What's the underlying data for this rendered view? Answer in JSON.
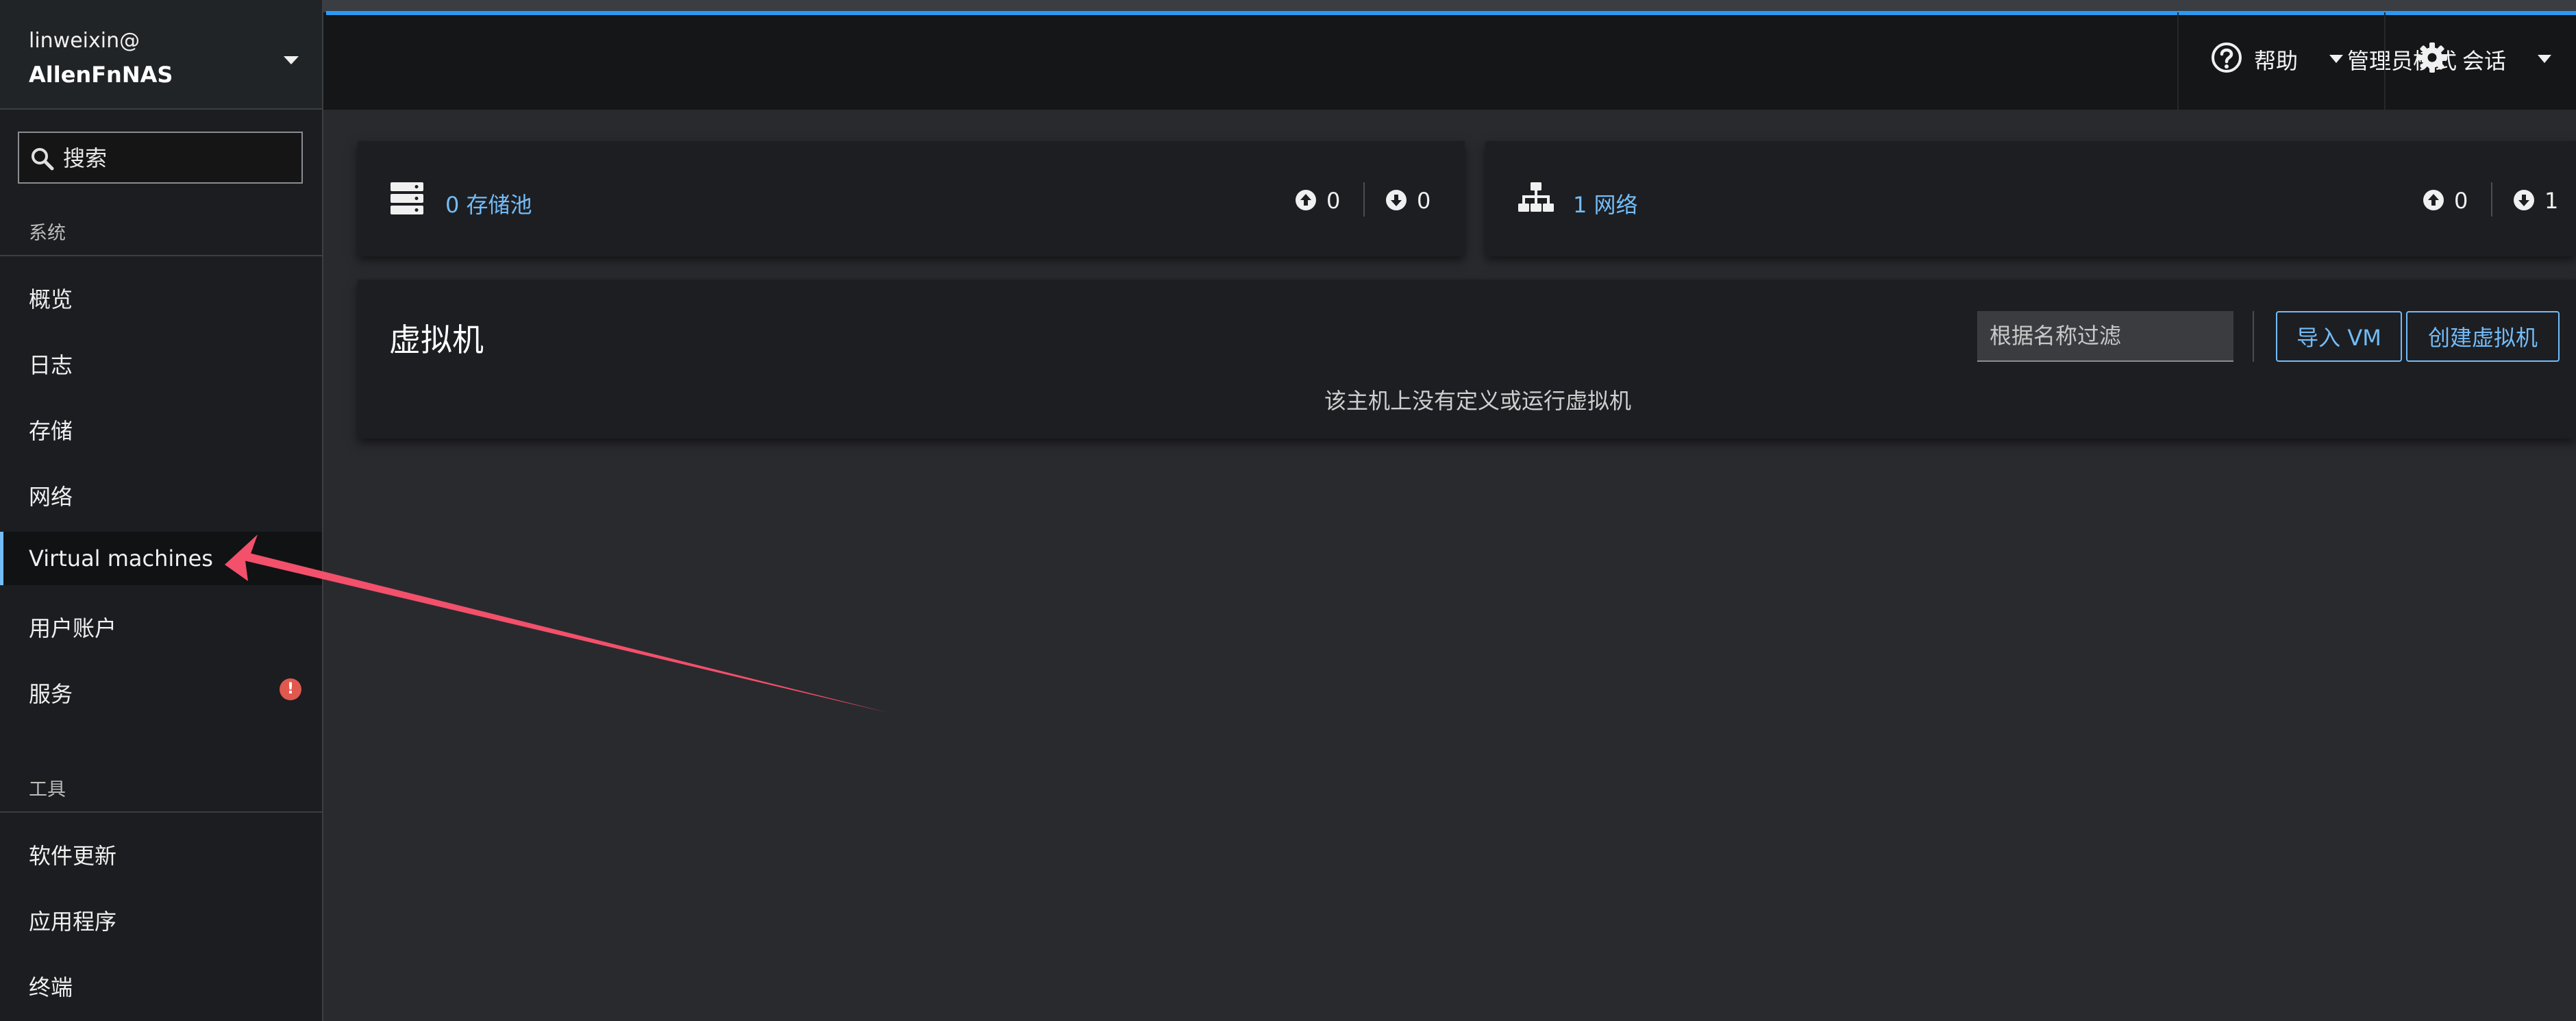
{
  "host": {
    "user": "linweixin@",
    "name": "AllenFnNAS"
  },
  "search": {
    "placeholder": "搜索"
  },
  "sidebar": {
    "sections": [
      {
        "title": "系统",
        "items": [
          {
            "label": "概览"
          },
          {
            "label": "日志"
          },
          {
            "label": "存储"
          },
          {
            "label": "网络"
          },
          {
            "label": "Virtual machines",
            "active": true
          },
          {
            "label": "用户账户"
          },
          {
            "label": "服务",
            "badge": "!"
          }
        ]
      },
      {
        "title": "工具",
        "items": [
          {
            "label": "软件更新"
          },
          {
            "label": "应用程序"
          },
          {
            "label": "终端"
          }
        ]
      }
    ]
  },
  "topbar": {
    "admin_mode": "管理员模式",
    "help": "帮助",
    "session": "会话"
  },
  "storage_card": {
    "link": "0 存储池",
    "up_count": "0",
    "down_count": "0"
  },
  "network_card": {
    "link": "1 网络",
    "up_count": "0",
    "down_count": "1"
  },
  "vms": {
    "title": "虚拟机",
    "filter_placeholder": "根据名称过滤",
    "import_button": "导入 VM",
    "create_button": "创建虚拟机",
    "empty_message": "该主机上没有定义或运行虚拟机"
  },
  "colors": {
    "accent_link": "#73bcf7",
    "progress_bar": "#2b9af3",
    "badge_danger": "#e0584e",
    "annotation_arrow": "#f2506b"
  },
  "icons": {
    "search": "search-icon",
    "help": "help-circle-icon",
    "session": "gear-icon",
    "storage": "server-stack-icon",
    "network": "network-topology-icon",
    "up": "arrow-circle-up-icon",
    "down": "arrow-circle-down-icon",
    "badge": "exclamation-circle-icon"
  }
}
